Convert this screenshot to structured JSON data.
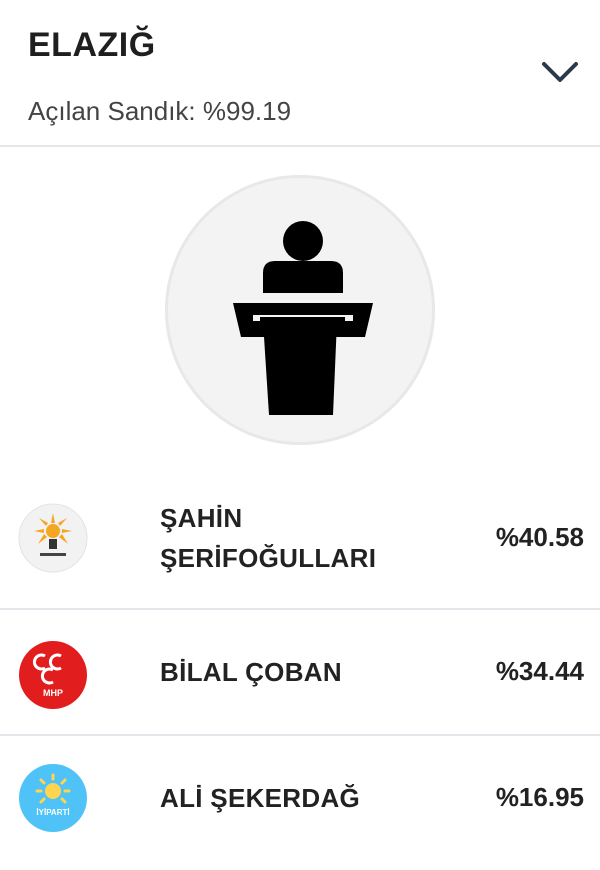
{
  "header": {
    "city": "ELAZIĞ",
    "opened_label": "Açılan Sandık: %99.19"
  },
  "candidates": [
    {
      "name": "ŞAHİN\nŞERİFOĞULLARI",
      "percent": "%40.58",
      "party_logo": "ak-parti-logo",
      "logo_text": "AK PARTİ",
      "logo_color": "#f5a623"
    },
    {
      "name": "BİLAL ÇOBAN",
      "percent": "%34.44",
      "party_logo": "mhp-logo",
      "logo_text": "MHP",
      "logo_color": "#e21d1d"
    },
    {
      "name": "ALİ ŞEKERDAĞ",
      "percent": "%16.95",
      "party_logo": "iyi-parti-logo",
      "logo_text": "İYİPARTİ",
      "logo_color": "#4fc3f7"
    }
  ],
  "icons": {
    "expand": "chevron-down-icon",
    "hero": "podium-speaker-icon"
  }
}
